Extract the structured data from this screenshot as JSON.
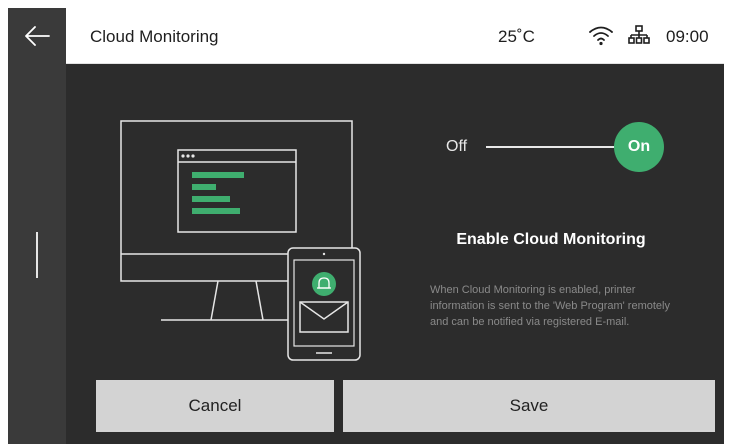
{
  "header": {
    "title": "Cloud Monitoring",
    "temperature": "25˚C",
    "time": "09:00"
  },
  "icons": {
    "back": "back-arrow-icon",
    "wifi": "wifi-icon",
    "network": "network-icon",
    "bell": "bell-icon",
    "envelope": "envelope-icon"
  },
  "toggle": {
    "off_label": "Off",
    "on_label": "On",
    "state": "on"
  },
  "main": {
    "heading": "Enable Cloud Monitoring",
    "description": "When Cloud Monitoring is enabled, printer information is sent to the 'Web Program' remotely and can be notified via registered E-mail."
  },
  "actions": {
    "cancel_label": "Cancel",
    "save_label": "Save"
  },
  "colors": {
    "accent": "#3fae6f",
    "panel": "#2c2c2c",
    "rail": "#3a3a3a",
    "button": "#d3d3d3"
  }
}
